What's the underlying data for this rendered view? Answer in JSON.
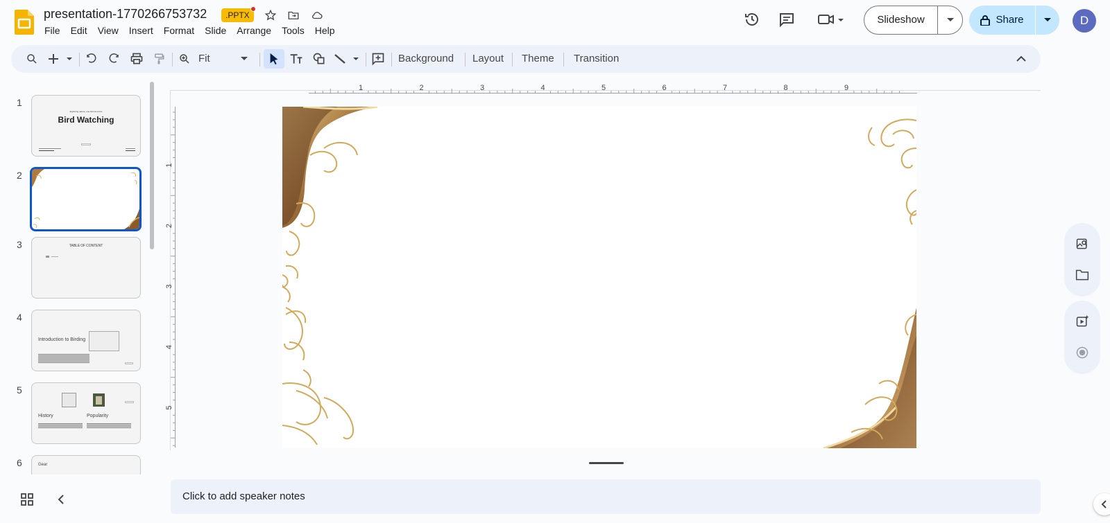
{
  "header": {
    "doc_title": "presentation-1770266753732",
    "file_badge": ".PPTX",
    "menu": [
      "File",
      "Edit",
      "View",
      "Insert",
      "Format",
      "Slide",
      "Arrange",
      "Tools",
      "Help"
    ],
    "slideshow_label": "Slideshow",
    "share_label": "Share",
    "avatar_letter": "D"
  },
  "toolbar": {
    "zoom_value": "Fit",
    "background_label": "Background",
    "layout_label": "Layout",
    "theme_label": "Theme",
    "transition_label": "Transition"
  },
  "ruler": {
    "h_labels": [
      "1",
      "2",
      "3",
      "4",
      "5",
      "6",
      "7",
      "8",
      "9"
    ],
    "v_labels": [
      "1",
      "2",
      "3",
      "4",
      "5"
    ]
  },
  "filmstrip": {
    "slides": [
      {
        "number": "1",
        "title": "Bird Watching",
        "subtitle": "Exploring nature, one bird at a time"
      },
      {
        "number": "2",
        "title": ""
      },
      {
        "number": "3",
        "title": "TABLE\u000bOF\u000bCONTENT"
      },
      {
        "number": "4",
        "title": "Introduction to Birding"
      },
      {
        "number": "5",
        "title_left": "History",
        "title_right": "Popularity"
      },
      {
        "number": "6",
        "title": "Gear"
      }
    ],
    "slide3_title_display": "TABLE&nbsp;OF&nbsp;CONTENT"
  },
  "notes": {
    "placeholder": "Click to add speaker notes"
  },
  "colors": {
    "accent": "#0b57d0",
    "share_bg": "#c2e7ff",
    "badge": "#f9bb00",
    "gold": "#c9a45a",
    "brown": "#6b4a2b"
  }
}
